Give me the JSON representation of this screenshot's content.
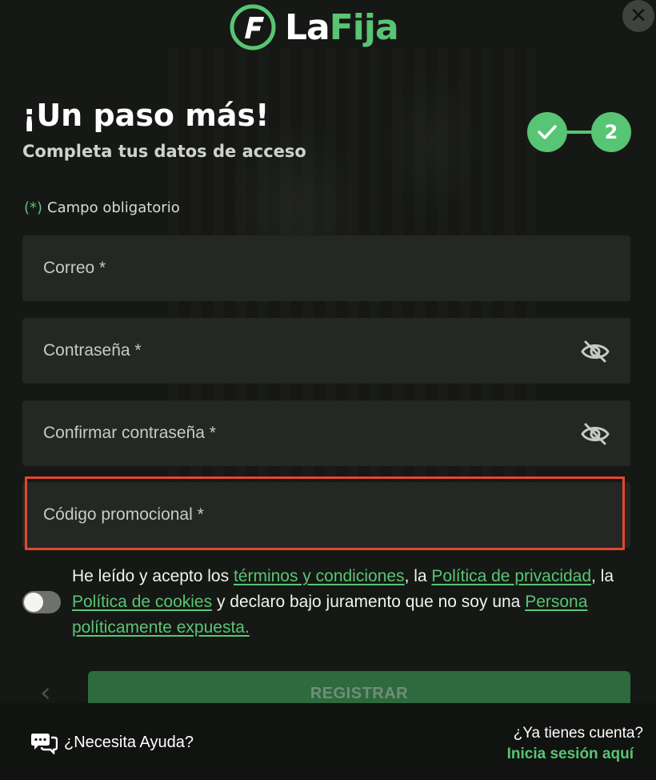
{
  "brand": {
    "part1": "La",
    "part2": "Fija",
    "accent": "#58c574"
  },
  "close": {
    "glyph": "✕"
  },
  "heading": {
    "title": "¡Un paso más!",
    "subtitle": "Completa tus datos de acceso"
  },
  "steps": {
    "step1_icon": "check-icon",
    "step2_label": "2"
  },
  "required_note": {
    "mark": "(*)",
    "text": "Campo obligatorio"
  },
  "fields": {
    "email": {
      "label": "Correo *"
    },
    "password": {
      "label": "Contraseña *",
      "icon": "eye-off-icon"
    },
    "confirm_password": {
      "label": "Confirmar contraseña *",
      "icon": "eye-off-icon"
    },
    "promo_code": {
      "label": "Código promocional *"
    }
  },
  "terms": {
    "t1": "He leído y acepto los ",
    "link_terms": "términos y condiciones",
    "t2": ", la ",
    "link_privacy": "Política de privacidad",
    "t3": ", la ",
    "link_cookies": "Política de cookies",
    "t4": " y declaro bajo juramento que no soy una ",
    "link_pep": "Persona políticamente expuesta."
  },
  "actions": {
    "back_glyph": "‹",
    "register_label": "REGISTRAR"
  },
  "footer": {
    "help_label": "¿Necesita Ayuda?",
    "have_account": "¿Ya tienes cuenta?",
    "login_link": "Inicia sesión aquí"
  }
}
